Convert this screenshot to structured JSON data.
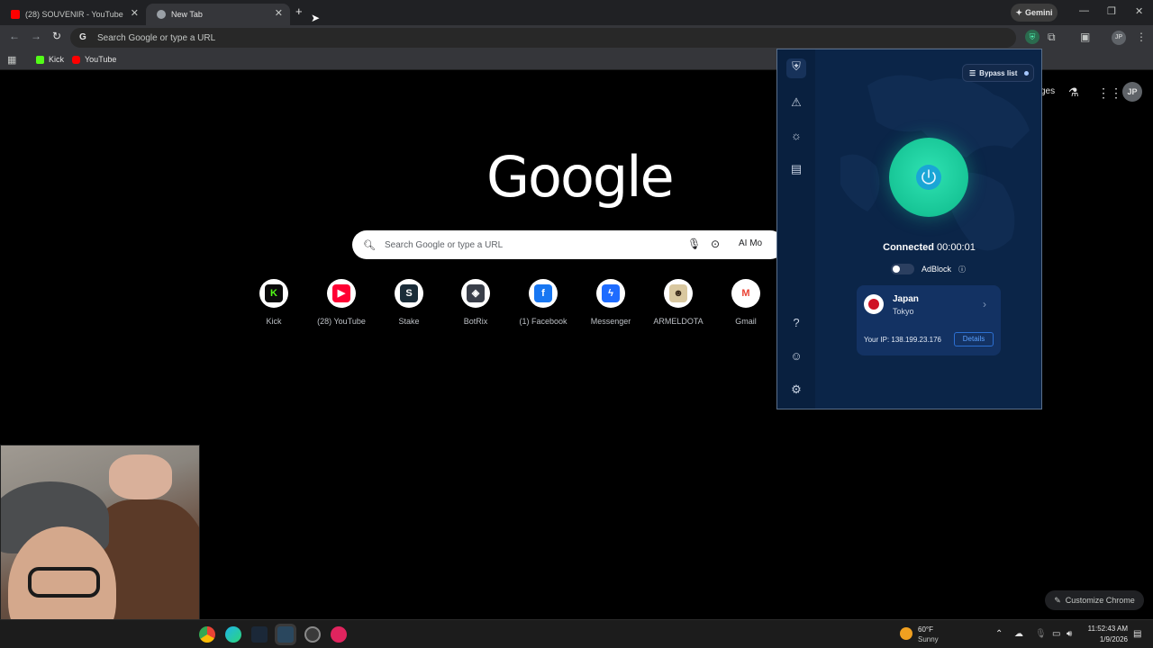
{
  "tabs": [
    {
      "title": "(28) SOUVENIR - YouTube",
      "active": false,
      "favicon_color": "#ff0000"
    },
    {
      "title": "New Tab",
      "active": true,
      "favicon_color": "#9aa0a6"
    }
  ],
  "new_tab_glyph": "+",
  "gemini_label": "Gemini",
  "omnibox": {
    "placeholder": "Search Google or type a URL",
    "g_letter": "G"
  },
  "profile_initials": "JP",
  "bookmarks": [
    {
      "label": "Kick",
      "color": "#53fc18"
    },
    {
      "label": "YouTube",
      "color": "#ff0000"
    }
  ],
  "ntp": {
    "logo": "Google",
    "search_placeholder": "Search Google or type a URL",
    "ai_mode_label": "AI Mo",
    "images_label": "ges",
    "customize_label": "Customize Chrome",
    "shortcuts": [
      {
        "label": "Kick",
        "glyph": "K",
        "color": "#53fc18",
        "bg": "#0b0b0b"
      },
      {
        "label": "(28) YouTube",
        "glyph": "▶",
        "color": "#ffffff",
        "bg": "#ff0033"
      },
      {
        "label": "Stake",
        "glyph": "S",
        "color": "#ffffff",
        "bg": "#1a2c38"
      },
      {
        "label": "BotRix",
        "glyph": "◈",
        "color": "#ffffff",
        "bg": "#3a3f4a"
      },
      {
        "label": "(1) Facebook",
        "glyph": "f",
        "color": "#ffffff",
        "bg": "#1877f2"
      },
      {
        "label": "Messenger",
        "glyph": "ϟ",
        "color": "#ffffff",
        "bg": "#1e6cff"
      },
      {
        "label": "ARMELDOTA",
        "glyph": "☻",
        "color": "#3a2a1a",
        "bg": "#d9c8a0"
      },
      {
        "label": "Gmail",
        "glyph": "M",
        "color": "#ea4335",
        "bg": "#ffffff"
      }
    ]
  },
  "vpn": {
    "bypass_label": "Bypass list",
    "status": "Connected",
    "timer": "00:00:01",
    "adblock_label": "AdBlock",
    "adblock_on": false,
    "country": "Japan",
    "city": "Tokyo",
    "ip_text": "Your IP: 138.199.23.176",
    "details_label": "Details",
    "accent": "#1fd6a6"
  },
  "taskbar": {
    "temperature": "60°F",
    "condition": "Sunny",
    "time": "11:52:43 AM",
    "date": "1/9/2026"
  }
}
